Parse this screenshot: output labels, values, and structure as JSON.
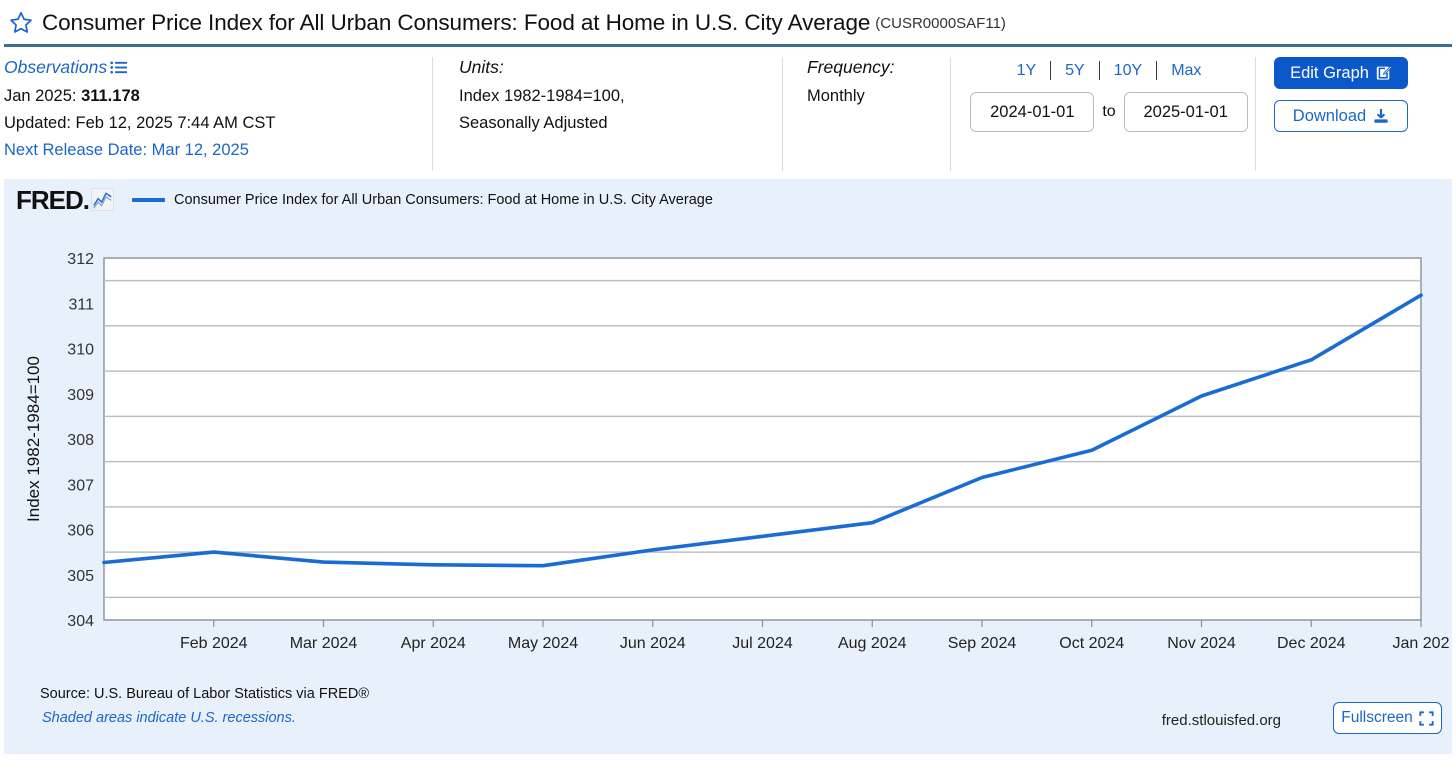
{
  "header": {
    "star_icon": "star-outline-icon",
    "title": "Consumer Price Index for All Urban Consumers: Food at Home in U.S. City Average",
    "series_id": "(CUSR0000SAF11)"
  },
  "observations": {
    "heading": "Observations",
    "list_icon": "list-icon",
    "latest": "Jan 2025: ",
    "latest_value": "311.178",
    "updated": "Updated: Feb 12, 2025 7:44 AM CST",
    "next_release": "Next Release Date: Mar 12, 2025"
  },
  "units": {
    "heading": "Units:",
    "line1": "Index 1982-1984=100,",
    "line2": "Seasonally Adjusted"
  },
  "frequency": {
    "heading": "Frequency:",
    "value": "Monthly"
  },
  "range": {
    "quick": [
      "1Y",
      "5Y",
      "10Y",
      "Max"
    ],
    "start": "2024-01-01",
    "end": "2025-01-01",
    "to_label": "to"
  },
  "actions": {
    "edit_graph": "Edit Graph",
    "edit_icon": "edit-pencil-icon",
    "download": "Download",
    "download_icon": "download-icon"
  },
  "graph": {
    "logo": "FRED",
    "logo_dot": ".",
    "logo_icon": "fred-chart-icon",
    "legend_label": "Consumer Price Index for All Urban Consumers: Food at Home in U.S. City Average",
    "line_color": "#1a6bd4",
    "panel_bg": "#e8f0fb"
  },
  "footer": {
    "source": "Source: U.S. Bureau of Labor Statistics via FRED®",
    "recession_note": "Shaded areas indicate U.S. recessions.",
    "url": "fred.stlouisfed.org",
    "fullscreen": "Fullscreen",
    "fullscreen_icon": "fullscreen-icon"
  },
  "chart_data": {
    "type": "line",
    "title": "Consumer Price Index for All Urban Consumers: Food at Home in U.S. City Average",
    "xlabel": "",
    "ylabel": "Index 1982-1984=100",
    "ylim": [
      304,
      312
    ],
    "yticks": [
      304,
      305,
      306,
      307,
      308,
      309,
      310,
      311,
      312
    ],
    "gridlines": [
      304.5,
      305.5,
      306.5,
      307.5,
      308.5,
      309.5,
      310.5,
      311.5
    ],
    "grid": true,
    "legend_position": "top",
    "categories": [
      "Jan 2024",
      "Feb 2024",
      "Mar 2024",
      "Apr 2024",
      "May 2024",
      "Jun 2024",
      "Jul 2024",
      "Aug 2024",
      "Sep 2024",
      "Oct 2024",
      "Nov 2024",
      "Dec 2024",
      "Jan 2025"
    ],
    "xtick_labels": [
      "Feb 2024",
      "Mar 2024",
      "Apr 2024",
      "May 2024",
      "Jun 2024",
      "Jul 2024",
      "Aug 2024",
      "Sep 2024",
      "Oct 2024",
      "Nov 2024",
      "Dec 2024",
      "Jan 202"
    ],
    "series": [
      {
        "name": "Consumer Price Index for All Urban Consumers: Food at Home in U.S. City Average",
        "color": "#1a6bd4",
        "values": [
          305.27,
          305.5,
          305.28,
          305.22,
          305.2,
          305.55,
          305.85,
          306.15,
          307.15,
          307.75,
          308.95,
          309.75,
          311.178
        ]
      }
    ]
  }
}
